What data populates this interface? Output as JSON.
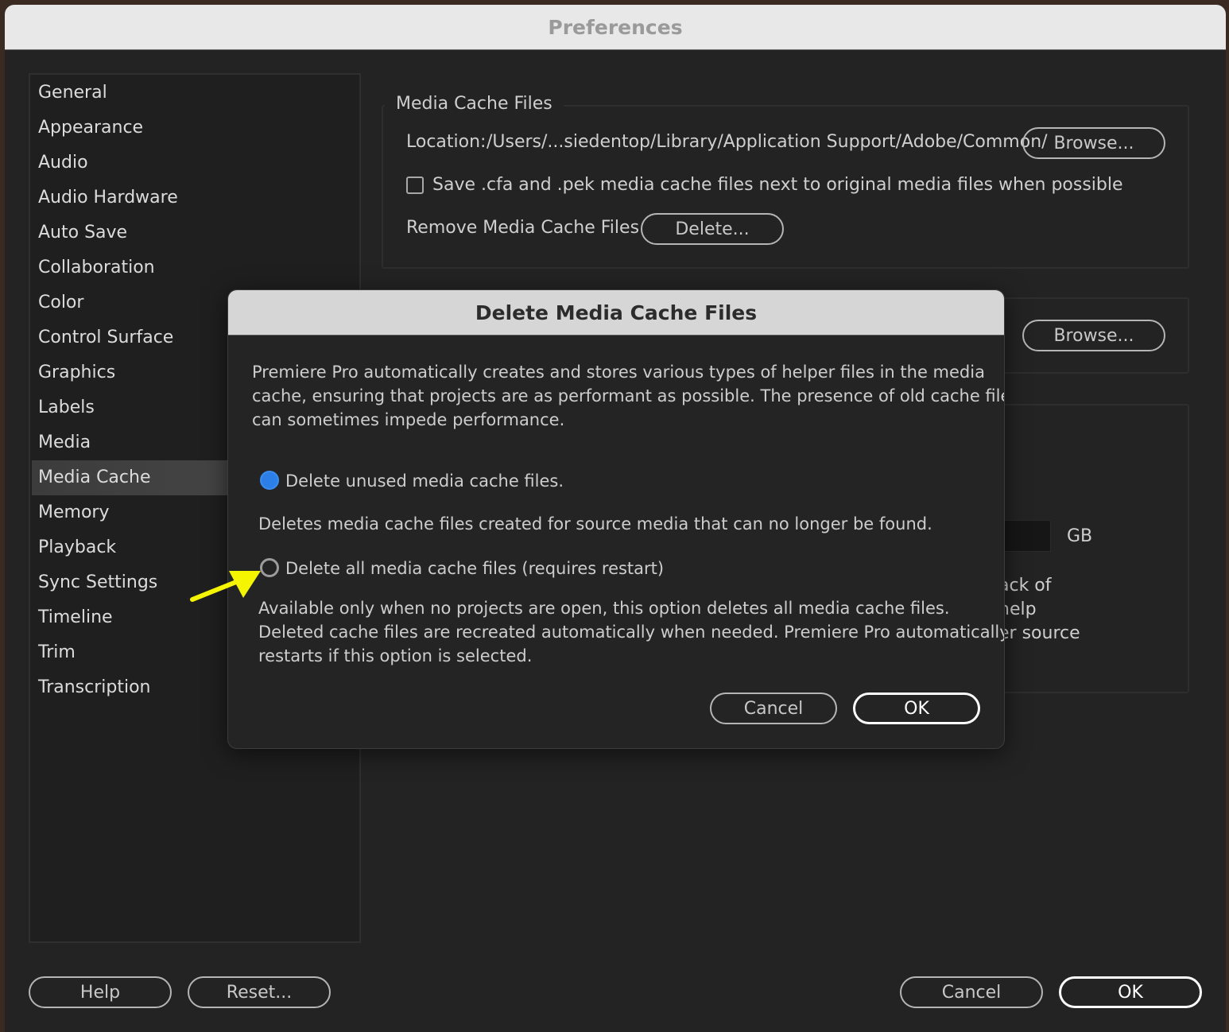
{
  "window": {
    "title": "Preferences"
  },
  "sidebar": {
    "items": [
      {
        "label": "General"
      },
      {
        "label": "Appearance"
      },
      {
        "label": "Audio"
      },
      {
        "label": "Audio Hardware"
      },
      {
        "label": "Auto Save"
      },
      {
        "label": "Collaboration"
      },
      {
        "label": "Color"
      },
      {
        "label": "Control Surface"
      },
      {
        "label": "Graphics"
      },
      {
        "label": "Labels"
      },
      {
        "label": "Media"
      },
      {
        "label": "Media Cache",
        "selected": true
      },
      {
        "label": "Memory"
      },
      {
        "label": "Playback"
      },
      {
        "label": "Sync Settings"
      },
      {
        "label": "Timeline"
      },
      {
        "label": "Trim"
      },
      {
        "label": "Transcription"
      }
    ]
  },
  "media_cache_files": {
    "legend": "Media Cache Files",
    "location_label": "Location:",
    "location_value": "/Users/...siedentop/Library/Application Support/Adobe/Common/",
    "browse_label": "Browse...",
    "save_checkbox_label": "Save .cfa and .pek media cache files next to original media files when possible",
    "save_checked": false,
    "remove_label": "Remove Media Cache Files",
    "delete_label": "Delete..."
  },
  "second_group": {
    "browse_label": "Browse..."
  },
  "third_group": {
    "unit_label": "GB",
    "partial_lines": [
      "ack of",
      "help",
      "er source"
    ]
  },
  "footer": {
    "help_label": "Help",
    "reset_label": "Reset...",
    "cancel_label": "Cancel",
    "ok_label": "OK"
  },
  "dialog": {
    "title": "Delete Media Cache Files",
    "intro_lines": [
      "Premiere Pro automatically creates and stores various types of helper files in the media",
      "cache, ensuring that projects are as performant as possible. The presence of old cache files",
      "can sometimes impede performance."
    ],
    "option_unused": {
      "label": "Delete unused media cache files.",
      "selected": true,
      "description": "Deletes media cache files created for source media that can no longer be found."
    },
    "option_all": {
      "label": "Delete all media cache files (requires restart)",
      "selected": false,
      "description_lines": [
        "Available only when no projects are open, this option deletes all media cache files.",
        "Deleted cache files are recreated automatically when needed. Premiere Pro automatically",
        "restarts if this option is selected."
      ]
    },
    "cancel_label": "Cancel",
    "ok_label": "OK"
  },
  "annotation": {
    "arrow_color": "#f5f500"
  },
  "colors": {
    "radio_selected": "#2d7fe8",
    "selected_row": "#454545"
  }
}
